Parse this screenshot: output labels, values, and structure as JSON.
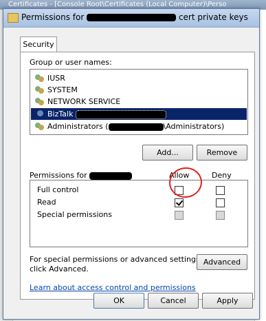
{
  "background": {
    "window_title": "Certificates - [Console Root\\Certificates (Local Computer)\\Perso"
  },
  "dialog": {
    "title_prefix": "Permissions for",
    "title_suffix": "cert private keys",
    "tab": "Security",
    "group_label": "Group or user names:",
    "users": [
      {
        "name": "IUSR",
        "icon": "users-group-icon"
      },
      {
        "name": "SYSTEM",
        "icon": "users-group-icon"
      },
      {
        "name": "NETWORK SERVICE",
        "icon": "users-group-icon"
      },
      {
        "name": "BizTalk",
        "icon": "user-icon",
        "selected": true
      },
      {
        "name": "Administrators (",
        "suffix": "\\Administrators)",
        "icon": "users-group-icon"
      }
    ],
    "add_button": "Add...",
    "remove_button": "Remove",
    "permissions_label": "Permissions for",
    "allow_header": "Allow",
    "deny_header": "Deny",
    "permissions": [
      {
        "name": "Full control",
        "allow": false,
        "deny": false,
        "disabled": false
      },
      {
        "name": "Read",
        "allow": true,
        "deny": false,
        "disabled": false
      },
      {
        "name": "Special permissions",
        "allow": false,
        "deny": false,
        "disabled": true
      }
    ],
    "special_text_line1": "For special permissions or advanced settings,",
    "special_text_line2": "click Advanced.",
    "advanced_button": "Advanced",
    "help_link": "Learn about access control and permissions",
    "ok_button": "OK",
    "cancel_button": "Cancel",
    "apply_button": "Apply"
  },
  "colors": {
    "selection": "#0a246a",
    "annotation_circle": "#e02020",
    "link": "#0645ad"
  }
}
